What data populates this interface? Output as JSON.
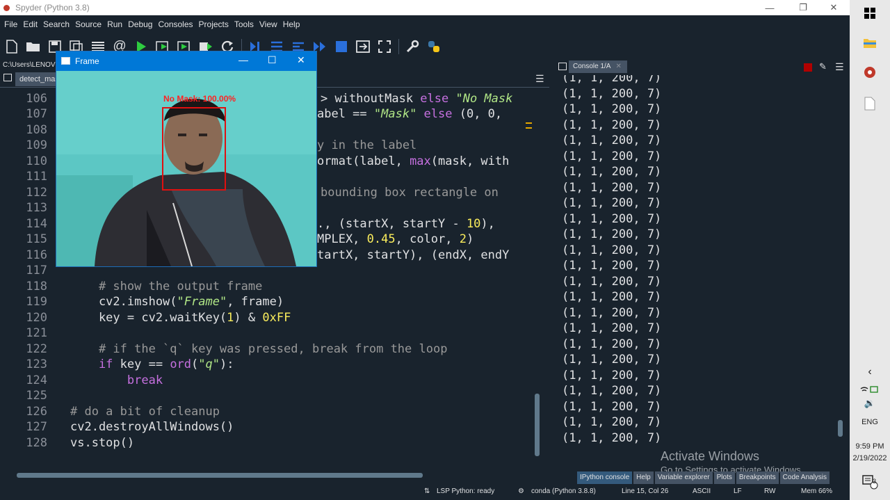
{
  "window": {
    "title": "Spyder (Python 3.8)"
  },
  "menu": [
    "File",
    "Edit",
    "Search",
    "Source",
    "Run",
    "Debug",
    "Consoles",
    "Projects",
    "Tools",
    "View",
    "Help"
  ],
  "toolbar_icons": [
    "new-file-icon",
    "open-folder-icon",
    "save-icon",
    "save-all-icon",
    "outline-icon",
    "at-icon",
    "run-icon",
    "run-cell-icon",
    "run-cell-advance-icon",
    "run-selection-icon",
    "rerun-icon",
    "step-icon",
    "debug-cell-icon",
    "debug-step-icon",
    "continue-icon",
    "stop-icon",
    "maximize-pane-icon",
    "fullscreen-icon",
    "wrench-icon",
    "python-path-icon"
  ],
  "path": "C:\\Users\\LENOVO",
  "editor_tab": "detect_mask",
  "frame_window": {
    "title": "Frame",
    "overlay_label": "No Mask: 100.00%",
    "label_color": "#ff2222",
    "box_color": "#e01010"
  },
  "editor": {
    "line_numbers": [
      "106",
      "107",
      "108",
      "109",
      "110",
      "111",
      "112",
      "113",
      "114",
      "115",
      "116",
      "117",
      "118",
      "119",
      "120",
      "121",
      "122",
      "123",
      "124",
      "125",
      "126",
      "127",
      "128"
    ],
    "visible_fragments": {
      "l106": "> withoutMask ",
      "l106kw": "else ",
      "l106str": "\"No Mask",
      "l107a": "abel == ",
      "l107str": "\"Mask\" ",
      "l107kw": "else ",
      "l107b": "(0, 0,",
      "l109": "y in the label",
      "l110": "ormat(label, ",
      "l110bi": "max",
      "l110b": "(mask, with",
      "l112": "bounding box rectangle on",
      "l114": "., (startX, startY - ",
      "l114n": "10",
      "l114b": "),",
      "l115": "MPLEX, ",
      "l115n": "0.45",
      "l115b": ", color, ",
      "l115n2": "2",
      "l115c": ")",
      "l116": "tartX, startY), (endX, endY"
    },
    "l118": "    # show the output frame",
    "l119a": "    cv2.imshow(",
    "l119str": "\"Frame\"",
    "l119b": ", frame)",
    "l120a": "    key = cv2.waitKey(",
    "l120n": "1",
    "l120b": ") & ",
    "l120n2": "0xFF",
    "l122": "    # if the `q` key was pressed, break from the loop",
    "l123kw": "    if ",
    "l123a": "key == ",
    "l123bi": "ord",
    "l123b": "(",
    "l123str": "\"q\"",
    "l123c": "):",
    "l124kw": "        break",
    "l126": "# do a bit of cleanup",
    "l127": "cv2.destroyAllWindows()",
    "l128": "vs.stop()"
  },
  "console": {
    "tab": "Console 1/A",
    "lines": [
      "(1, 1, 200, 7)",
      "(1, 1, 200, 7)",
      "(1, 1, 200, 7)",
      "(1, 1, 200, 7)",
      "(1, 1, 200, 7)",
      "(1, 1, 200, 7)",
      "(1, 1, 200, 7)",
      "(1, 1, 200, 7)",
      "(1, 1, 200, 7)",
      "(1, 1, 200, 7)",
      "(1, 1, 200, 7)",
      "(1, 1, 200, 7)",
      "(1, 1, 200, 7)",
      "(1, 1, 200, 7)",
      "(1, 1, 200, 7)",
      "(1, 1, 200, 7)",
      "(1, 1, 200, 7)",
      "(1, 1, 200, 7)",
      "(1, 1, 200, 7)",
      "(1, 1, 200, 7)",
      "(1, 1, 200, 7)",
      "(1, 1, 200, 7)",
      "(1, 1, 200, 7)",
      "(1, 1, 200, 7)"
    ]
  },
  "pane_tabs": [
    "IPython console",
    "Help",
    "Variable explorer",
    "Plots",
    "Breakpoints",
    "Code Analysis"
  ],
  "watermark": {
    "line1": "Activate Windows",
    "line2": "Go to Settings to activate Windows."
  },
  "status": {
    "lsp": "LSP Python: ready",
    "conda": "conda (Python 3.8.8)",
    "position": "Line 15, Col 26",
    "encoding": "ASCII",
    "eol": "LF",
    "rw": "RW",
    "mem": "Mem 66%"
  },
  "taskbar": {
    "lang": "ENG",
    "time": "9:59 PM",
    "date": "2/19/2022",
    "notif_count": "3"
  }
}
